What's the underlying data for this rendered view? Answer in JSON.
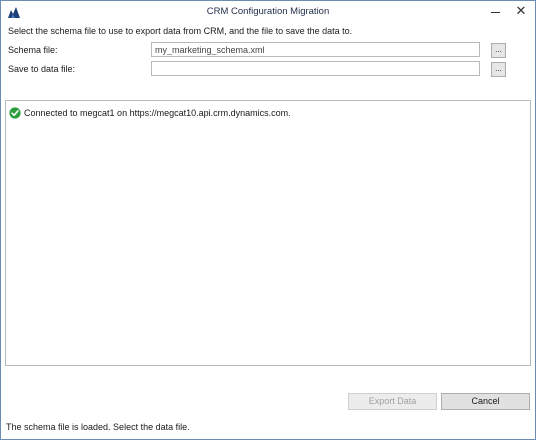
{
  "window": {
    "title": "CRM Configuration Migration",
    "close_glyph": "✕"
  },
  "form": {
    "instruction": "Select the schema file to use to export data from CRM, and the file to save the data to.",
    "schema_file": {
      "label": "Schema file:",
      "value": "my_marketing_schema.xml",
      "browse_label": "..."
    },
    "data_file": {
      "label": "Save to data file:",
      "value": "",
      "browse_label": "..."
    }
  },
  "log": {
    "entries": [
      {
        "icon": "check-circle-icon",
        "text": "Connected to megcat1 on https://megcat10.api.crm.dynamics.com."
      }
    ]
  },
  "buttons": {
    "export_label": "Export Data",
    "export_enabled": false,
    "cancel_label": "Cancel"
  },
  "status_bar": {
    "text": "The schema file is loaded. Select the data file."
  },
  "colors": {
    "success_green": "#2e9e3e",
    "brand_blue": "#1d3f79",
    "border": "#b9b9b9"
  }
}
